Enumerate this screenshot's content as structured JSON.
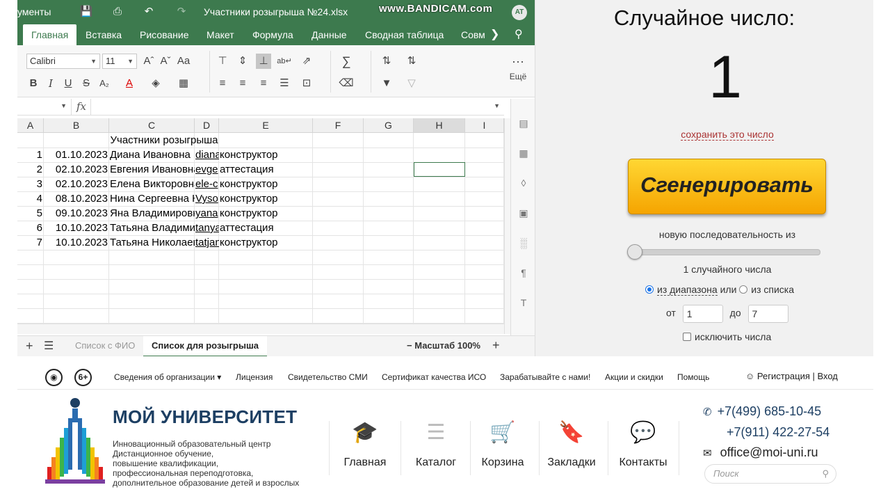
{
  "sheet": {
    "docs_label": "ументы",
    "filename": "Участники розыгрыша №24.xlsx",
    "watermark": "www.BANDICAM.com",
    "avatar": "AT",
    "tabs": [
      "Главная",
      "Вставка",
      "Рисование",
      "Макет",
      "Формула",
      "Данные",
      "Сводная таблица",
      "Совм"
    ],
    "font_name": "Calibri",
    "font_size": "11",
    "more_label": "Ещё",
    "fx": "fx",
    "columns": [
      "A",
      "B",
      "C",
      "D",
      "E",
      "F",
      "G",
      "H",
      "I"
    ],
    "title_cell": "Участники розыгрыша",
    "rows": [
      {
        "a": "1",
        "b": "01.10.2023",
        "c": "Диана Ивановна",
        "d": "diana",
        "e": "конструктор"
      },
      {
        "a": "2",
        "b": "02.10.2023",
        "c": "Евгения Ивановна",
        "d": "evge",
        "e": "аттестация"
      },
      {
        "a": "3",
        "b": "02.10.2023",
        "c": "Елена Викторовна",
        "d": "ele-c",
        "e": "конструктор"
      },
      {
        "a": "4",
        "b": "08.10.2023",
        "c": "Нина Сергеевна К",
        "d": "Vyso",
        "e": "конструктор"
      },
      {
        "a": "5",
        "b": "09.10.2023",
        "c": "Яна Владимировна",
        "d": "yana",
        "e": "конструктор"
      },
      {
        "a": "6",
        "b": "10.10.2023",
        "c": "Татьяна Владимировна",
        "d": "tanya",
        "e": "аттестация"
      },
      {
        "a": "7",
        "b": "10.10.2023",
        "c": "Татьяна Николаевна",
        "d": "tatjan",
        "e": "конструктор"
      }
    ],
    "sheet_tabs": [
      "Список с ФИО",
      "Список для розыгрыша"
    ],
    "zoom_label": "Масштаб 100%"
  },
  "rng": {
    "title": "Случайное число:",
    "result": "1",
    "save_link": "сохранить это число",
    "generate_label": "Сгенерировать",
    "sequence_label": "новую последовательность из",
    "slider_fraction": 0,
    "count_label": "1 случайного числа",
    "mode_range": "из диапазона",
    "mode_or": "или",
    "mode_list": "из списка",
    "from_label": "от",
    "from_value": "1",
    "to_label": "до",
    "to_value": "7",
    "exclude_label": "исключить числа"
  },
  "site": {
    "age_badge": "6+",
    "nav": [
      "Сведения об организации",
      "Лицензия",
      "Свидетельство СМИ",
      "Сертификат качества ИСО",
      "Зарабатывайте с нами!",
      "Акции и скидки",
      "Помощь"
    ],
    "auth": "Регистрация | Вход",
    "brand_title": "МОЙ УНИВЕРСИТЕТ",
    "brand_desc": [
      "Инновационный образовательный центр",
      "Дистанционное обучение,",
      "повышение квалификации,",
      "профессиональная переподготовка,",
      "дополнительное образование детей и взрослых"
    ],
    "main_nav": [
      "Главная",
      "Каталог",
      "Корзина",
      "Закладки",
      "Контакты"
    ],
    "phone1": "+7(499) 685-10-45",
    "phone2": "+7(911) 422-27-54",
    "email": "office@moi-uni.ru",
    "search_placeholder": "Поиск"
  },
  "colors": {
    "app_green": "#3d7a4e",
    "button_orange": "#f5a400",
    "brand_blue": "#1d3f63"
  }
}
